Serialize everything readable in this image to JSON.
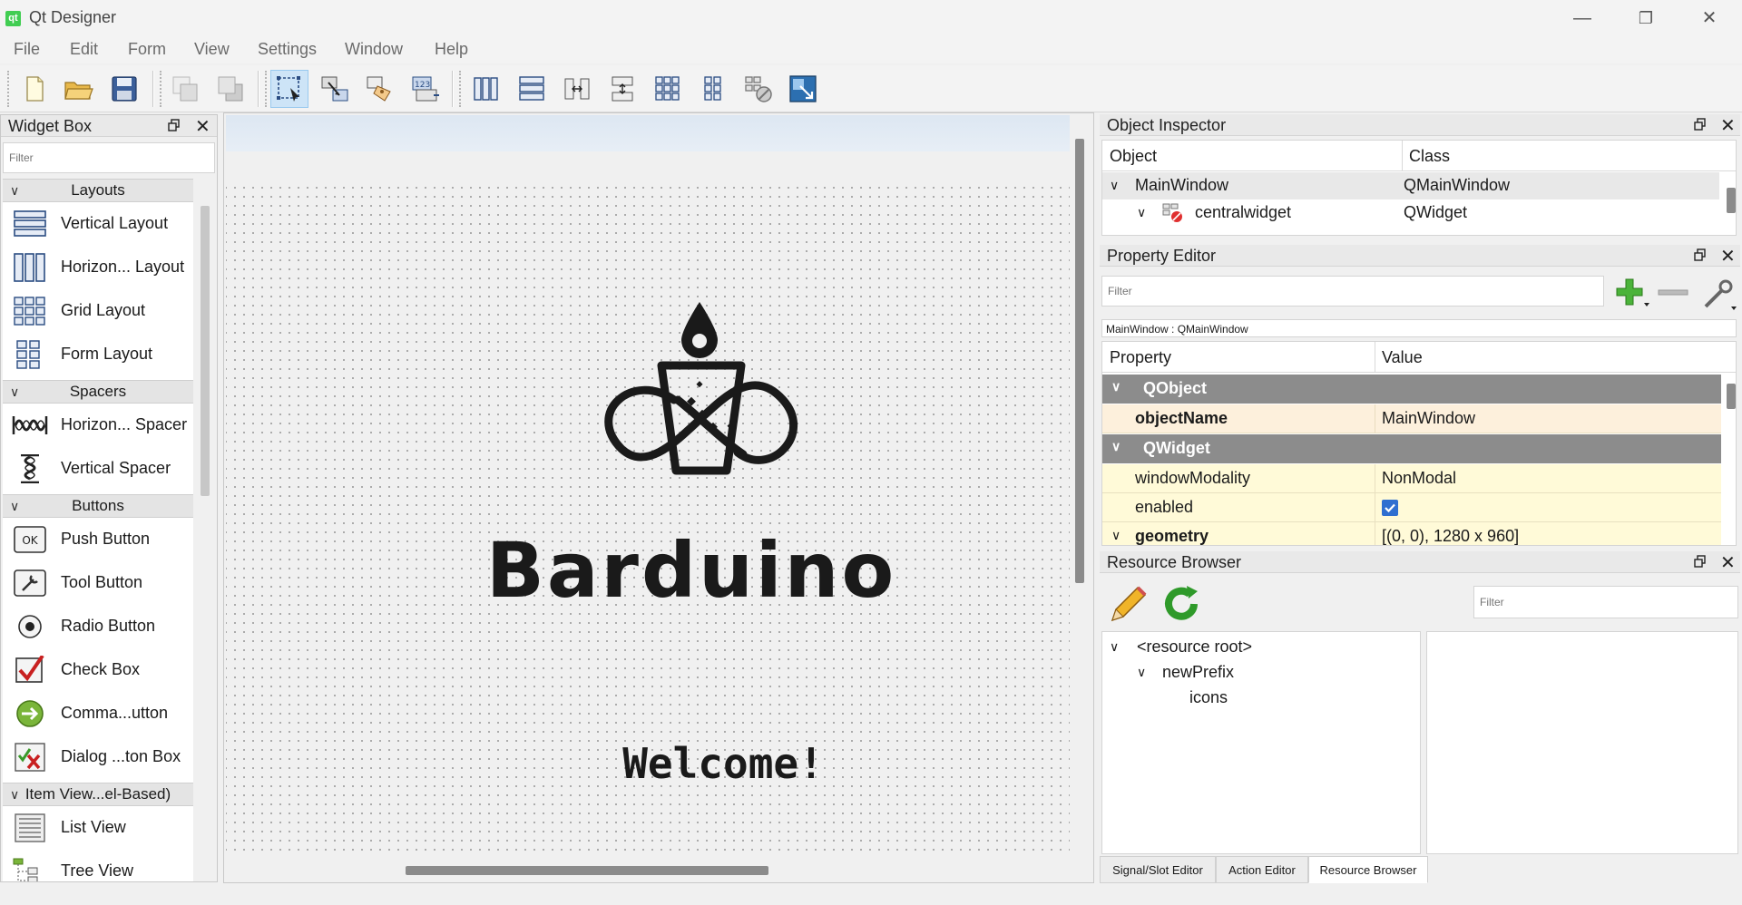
{
  "window": {
    "title": "Qt Designer",
    "minimize": "—",
    "restore": "❐",
    "close": "✕"
  },
  "menu": [
    "File",
    "Edit",
    "Form",
    "View",
    "Settings",
    "Window",
    "Help"
  ],
  "toolbar": {
    "buttons": [
      {
        "icon": "new-file-icon"
      },
      {
        "icon": "open-folder-icon"
      },
      {
        "icon": "save-icon"
      },
      {
        "icon": "send-to-back-icon"
      },
      {
        "icon": "bring-to-front-icon"
      },
      {
        "icon": "edit-widgets-icon",
        "active": true
      },
      {
        "icon": "edit-signals-slots-icon"
      },
      {
        "icon": "edit-buddies-icon"
      },
      {
        "icon": "edit-tab-order-icon"
      },
      {
        "icon": "layout-horizontal-icon"
      },
      {
        "icon": "layout-vertical-icon"
      },
      {
        "icon": "layout-horizontal-splitter-icon"
      },
      {
        "icon": "layout-vertical-splitter-icon"
      },
      {
        "icon": "layout-grid-icon"
      },
      {
        "icon": "layout-form-icon"
      },
      {
        "icon": "break-layout-icon"
      },
      {
        "icon": "adjust-size-icon"
      }
    ]
  },
  "widget_box": {
    "title": "Widget Box",
    "filter_placeholder": "Filter",
    "categories": [
      {
        "label": "Layouts",
        "items": [
          "Vertical Layout",
          "Horizon... Layout",
          "Grid Layout",
          "Form Layout"
        ]
      },
      {
        "label": "Spacers",
        "items": [
          "Horizon... Spacer",
          "Vertical Spacer"
        ]
      },
      {
        "label": "Buttons",
        "items": [
          "Push Button",
          "Tool Button",
          "Radio Button",
          "Check Box",
          "Comma...utton",
          "Dialog ...ton Box"
        ]
      },
      {
        "label": "Item View...el-Based)",
        "items": [
          "List View",
          "Tree View"
        ]
      }
    ],
    "push_button_icon_text": "OK"
  },
  "form": {
    "brand": "Barduino",
    "welcome": "Welcome!"
  },
  "object_inspector": {
    "title": "Object Inspector",
    "columns": [
      "Object",
      "Class"
    ],
    "rows": [
      {
        "object": "MainWindow",
        "class": "QMainWindow"
      },
      {
        "object": "centralwidget",
        "class": "QWidget"
      }
    ]
  },
  "property_editor": {
    "title": "Property Editor",
    "filter_placeholder": "Filter",
    "context": "MainWindow : QMainWindow",
    "columns": [
      "Property",
      "Value"
    ],
    "groups": [
      {
        "name": "QObject",
        "props": [
          {
            "name": "objectName",
            "value": "MainWindow"
          }
        ]
      },
      {
        "name": "QWidget",
        "props": [
          {
            "name": "windowModality",
            "value": "NonModal"
          },
          {
            "name": "enabled",
            "value": "",
            "checked": true
          },
          {
            "name": "geometry",
            "value": "[(0, 0), 1280 x 960]"
          }
        ]
      }
    ]
  },
  "resource_browser": {
    "title": "Resource Browser",
    "filter_placeholder": "Filter",
    "tree": [
      "<resource root>",
      "newPrefix",
      "icons"
    ]
  },
  "bottom_tabs": [
    "Signal/Slot Editor",
    "Action Editor",
    "Resource Browser"
  ],
  "colors": {
    "accent": "#2f6fd0",
    "group_header": "#8c8c8c",
    "highlight_row": "#fdf0dc",
    "yellow_row": "#fffad8"
  }
}
